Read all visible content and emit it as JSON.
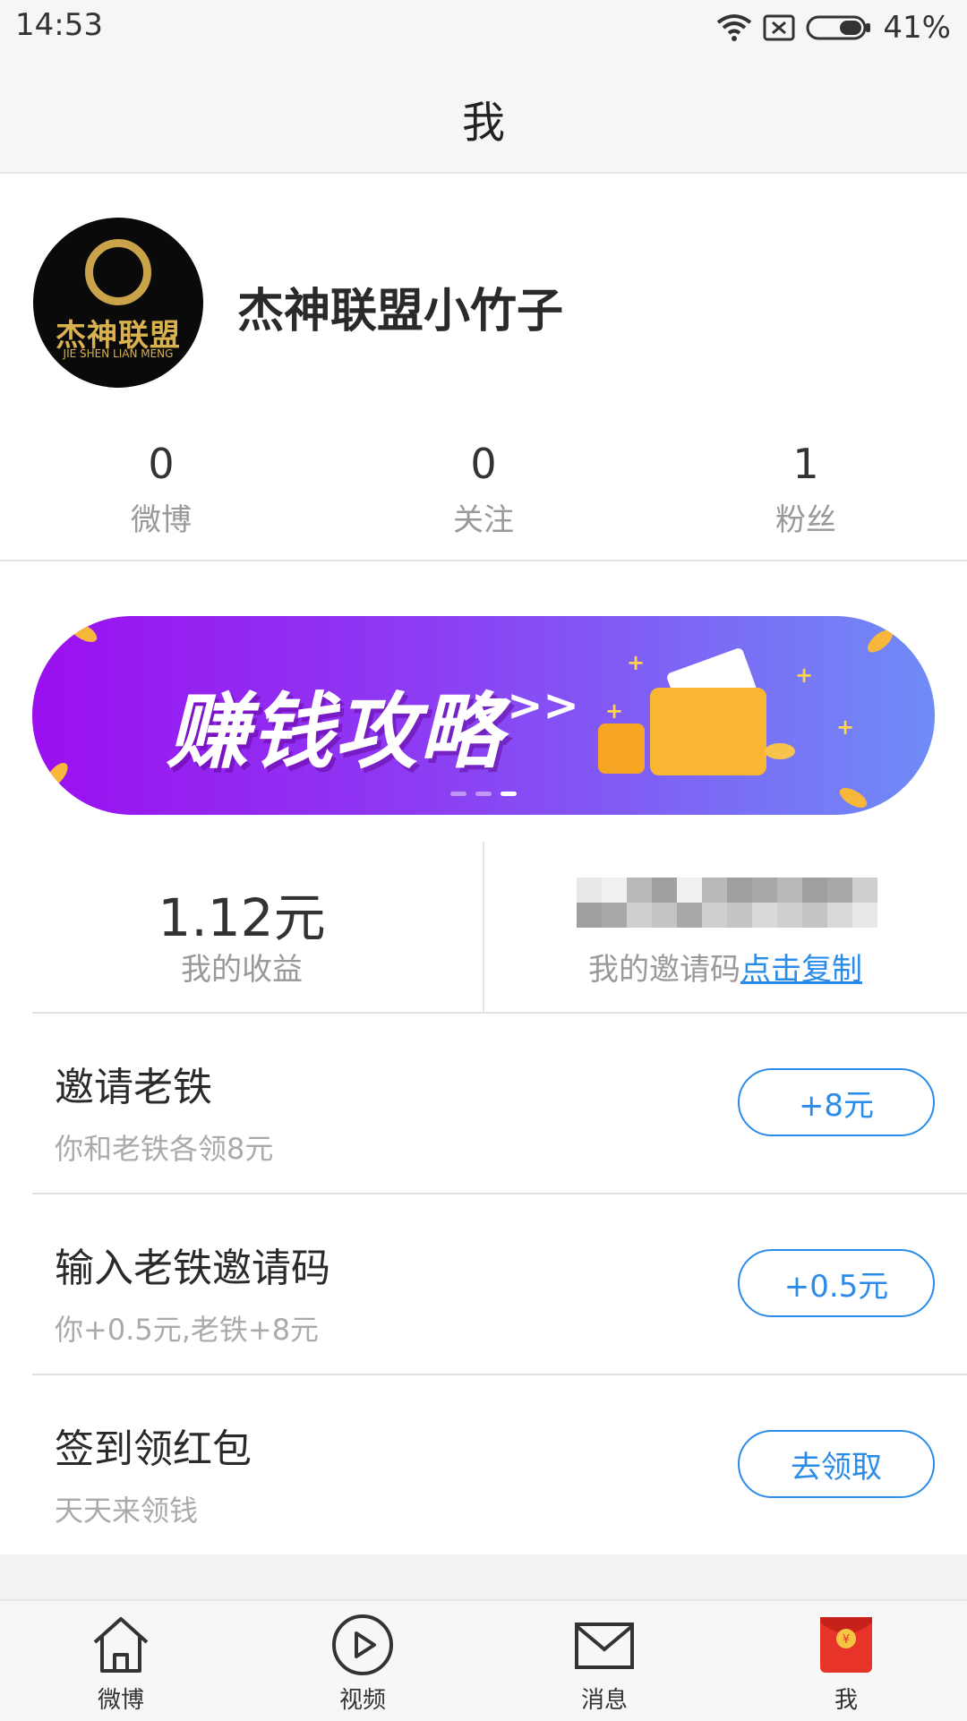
{
  "status_bar": {
    "time": "14:53",
    "battery_pct": "41%"
  },
  "header": {
    "title": "我"
  },
  "profile": {
    "avatar_logo_cn": "杰神联盟",
    "avatar_logo_en": "JIE SHEN LIAN MENG",
    "username": "杰神联盟小竹子",
    "stats": [
      {
        "value": "0",
        "label": "微博"
      },
      {
        "value": "0",
        "label": "关注"
      },
      {
        "value": "1",
        "label": "粉丝"
      }
    ]
  },
  "banner": {
    "text": "赚钱攻略",
    "arrows": ">>>",
    "active_slide": 3,
    "slide_count": 3
  },
  "earnings": {
    "value": "1.12元",
    "label": "我的收益",
    "invite_code_label": "我的邀请码",
    "copy_link": "点击复制"
  },
  "tasks": [
    {
      "title": "邀请老铁",
      "subtitle": "你和老铁各领8元",
      "button": "+8元"
    },
    {
      "title": "输入老铁邀请码",
      "subtitle": "你+0.5元,老铁+8元",
      "button": "+0.5元"
    },
    {
      "title": "签到领红包",
      "subtitle": "天天来领钱",
      "button": "去领取"
    }
  ],
  "bottom_nav": [
    {
      "label": "微博",
      "icon": "home-icon"
    },
    {
      "label": "视频",
      "icon": "play-icon"
    },
    {
      "label": "消息",
      "icon": "mail-icon"
    },
    {
      "label": "我",
      "icon": "red-envelope-icon"
    }
  ],
  "colors": {
    "accent": "#2a8be8",
    "banner_start": "#9b0ff0",
    "banner_end": "#6f8cf6",
    "red_envelope": "#e8332b"
  }
}
